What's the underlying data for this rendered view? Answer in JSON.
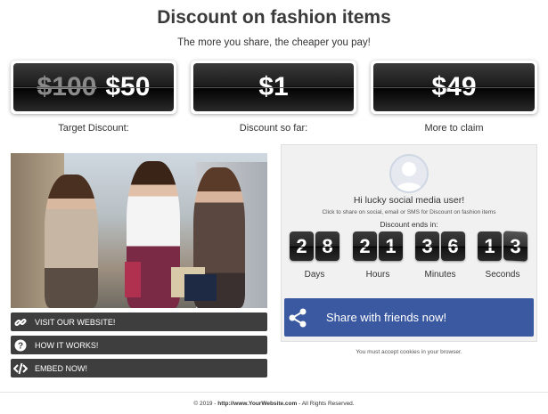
{
  "header": {
    "title": "Discount on fashion items",
    "subtitle": "The more you share, the cheaper you pay!"
  },
  "prices": [
    {
      "old": "$100",
      "value": "$50",
      "label": "Target Discount:"
    },
    {
      "old": "",
      "value": "$1",
      "label": "Discount so far:"
    },
    {
      "old": "",
      "value": "$49",
      "label": "More to claim"
    }
  ],
  "links": [
    {
      "label": "VISIT OUR WEBSITE!",
      "icon": "link-icon"
    },
    {
      "label": "HOW IT WORKS!",
      "icon": "question-icon"
    },
    {
      "label": "EMBED NOW!",
      "icon": "code-icon"
    }
  ],
  "panel": {
    "greeting": "Hi lucky social media user!",
    "instruction": "Click to share on social, email or SMS for Discount on fashion items",
    "ends_label": "Discount ends in:",
    "countdown": [
      {
        "digits": [
          "2",
          "8"
        ],
        "label": "Days"
      },
      {
        "digits": [
          "2",
          "1"
        ],
        "label": "Hours"
      },
      {
        "digits": [
          "3",
          "6"
        ],
        "label": "Minutes"
      },
      {
        "digits": [
          "1",
          "3"
        ],
        "label": "Seconds"
      }
    ]
  },
  "share": {
    "label": "Share with friends now!",
    "cookie_note": "You must accept cookies in your browser."
  },
  "footer": {
    "prefix": "© 2019 - ",
    "link": "http://www.YourWebsite.com",
    "suffix": " - All Rights Reserved."
  },
  "colors": {
    "share_blue": "#3b59a0",
    "dark_button": "#3e3e3e"
  }
}
